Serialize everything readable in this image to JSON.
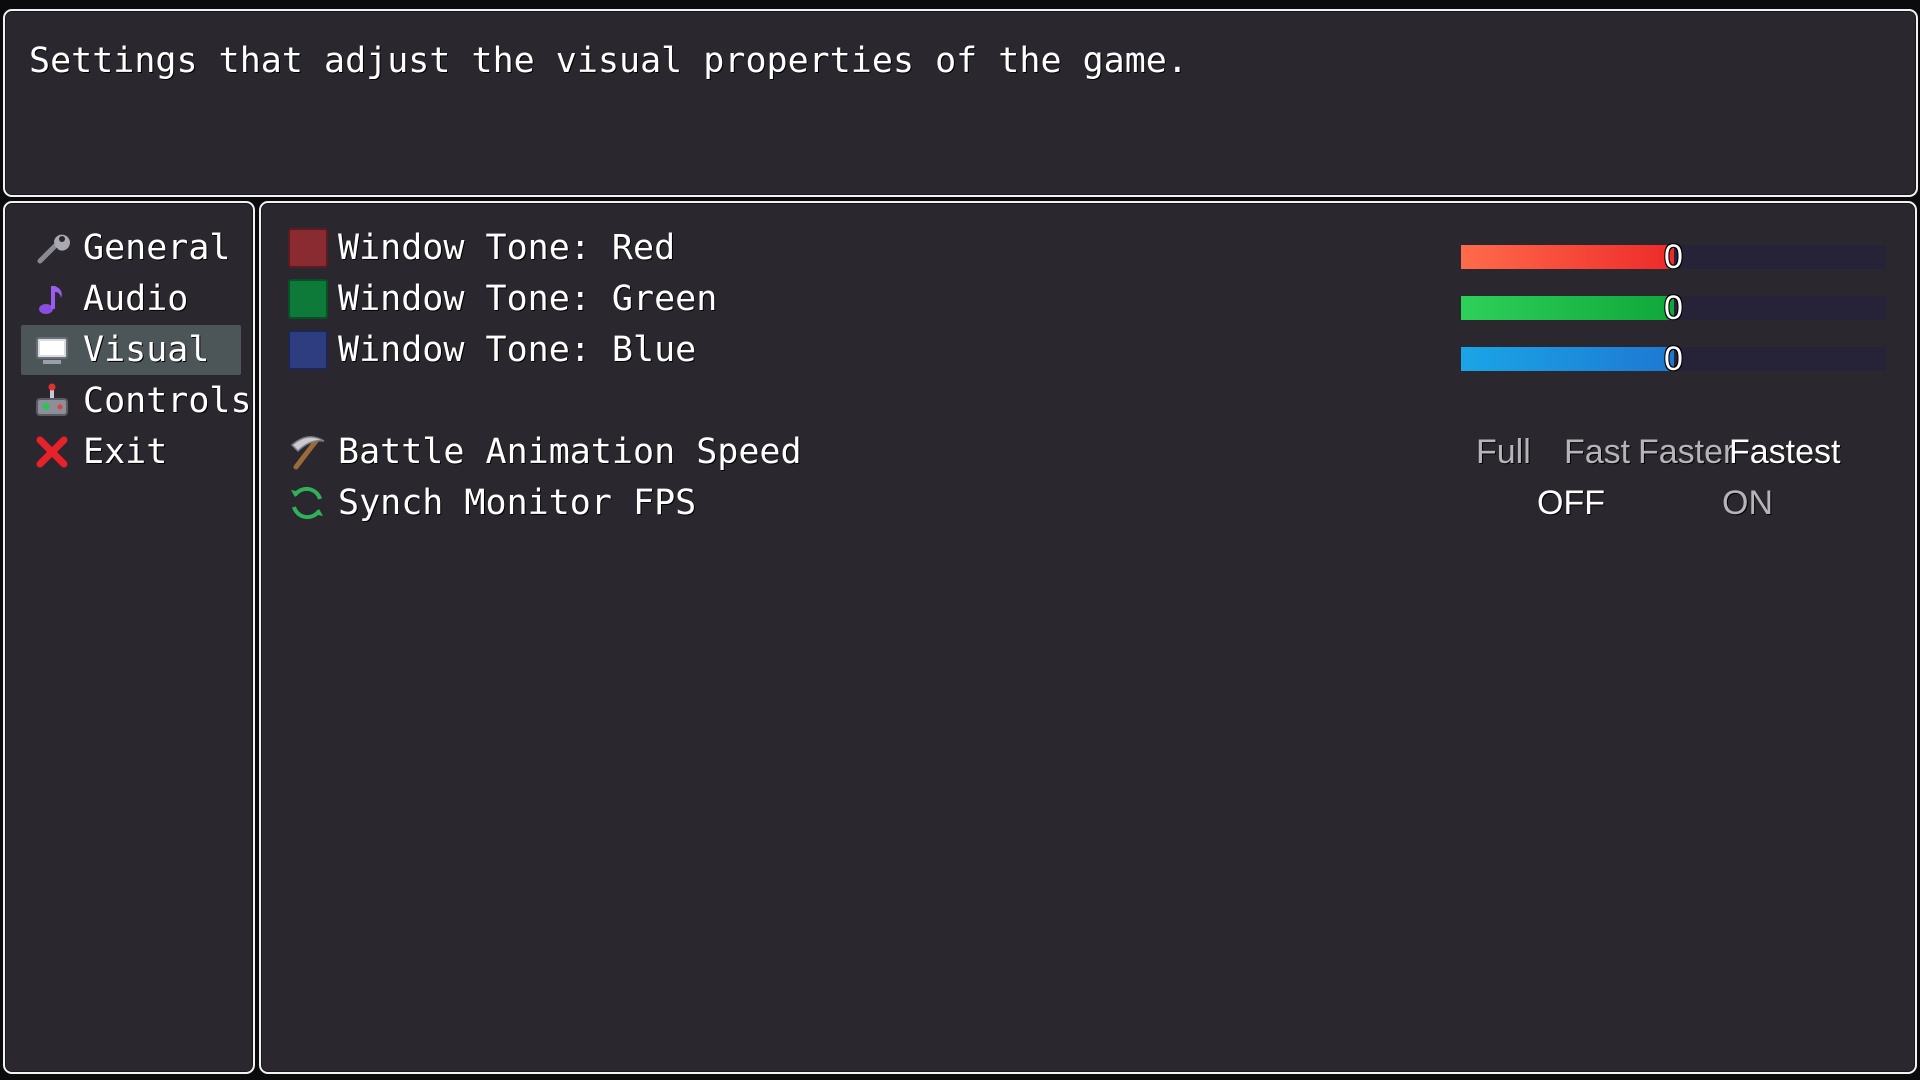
{
  "help": {
    "text": "Settings that adjust the visual properties of the game."
  },
  "categories": [
    {
      "label": "General",
      "icon": "wrench-icon",
      "selected": false
    },
    {
      "label": "Audio",
      "icon": "music-note-icon",
      "selected": false
    },
    {
      "label": "Visual",
      "icon": "monitor-icon",
      "selected": true
    },
    {
      "label": "Controls",
      "icon": "gamepad-icon",
      "selected": false
    },
    {
      "label": "Exit",
      "icon": "red-x-icon",
      "selected": false
    }
  ],
  "options": {
    "tone_red": {
      "label": "Window Tone: Red",
      "value": "0",
      "fill_fraction": 0.5,
      "swatch_color": "#8a2b31",
      "gauge_gradient": [
        "#ff6b4a",
        "#ee2a2a"
      ]
    },
    "tone_green": {
      "label": "Window Tone: Green",
      "value": "0",
      "fill_fraction": 0.5,
      "swatch_color": "#0e7a3a",
      "gauge_gradient": [
        "#2ed05a",
        "#0fa73a"
      ]
    },
    "tone_blue": {
      "label": "Window Tone: Blue",
      "value": "0",
      "fill_fraction": 0.5,
      "swatch_color": "#2e3c80",
      "gauge_gradient": [
        "#1aa5e6",
        "#1e78d2"
      ]
    },
    "battle_speed": {
      "label": "Battle Animation Speed",
      "icon": "pickaxe-icon",
      "choices": [
        "Full",
        "Fast",
        "Faster",
        "Fastest"
      ],
      "selected": "Fastest"
    },
    "synch_fps": {
      "label": "Synch Monitor FPS",
      "icon": "refresh-icon",
      "choices": [
        "OFF",
        "ON"
      ],
      "selected": "OFF"
    }
  }
}
